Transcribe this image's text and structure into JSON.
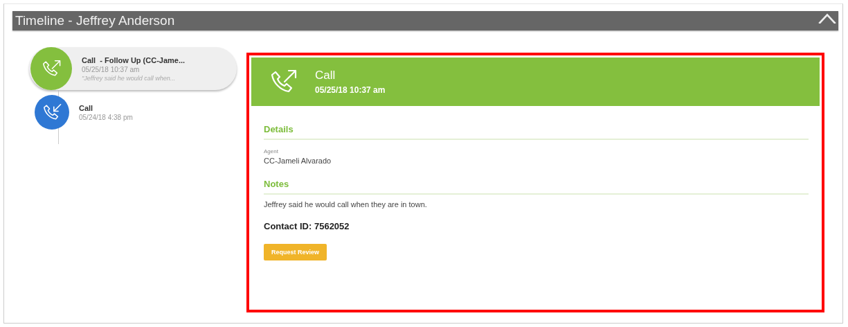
{
  "window": {
    "title": "Timeline - Jeffrey Anderson"
  },
  "timeline": [
    {
      "kind": "outgoing",
      "color": "#84bf3e",
      "selected": true,
      "title": "Call  - Follow Up (CC-Jame...",
      "time": "05/25/18 10:37 am",
      "snippet": "\"Jeffrey said he would call when..."
    },
    {
      "kind": "incoming",
      "color": "#2f78d4",
      "selected": false,
      "title": "Call",
      "time": "05/24/18 4:38 pm"
    }
  ],
  "detail": {
    "kind": "outgoing",
    "title": "Call",
    "time": "05/25/18 10:37 am",
    "sections": [
      {
        "heading": "Details",
        "fields": [
          {
            "label": "Agent",
            "value": "CC-Jameli Alvarado"
          }
        ]
      },
      {
        "heading": "Notes",
        "text": "Jeffrey said he would call when they are in town."
      }
    ],
    "contact_id": "Contact ID: 7562052",
    "button": "Request Review"
  }
}
